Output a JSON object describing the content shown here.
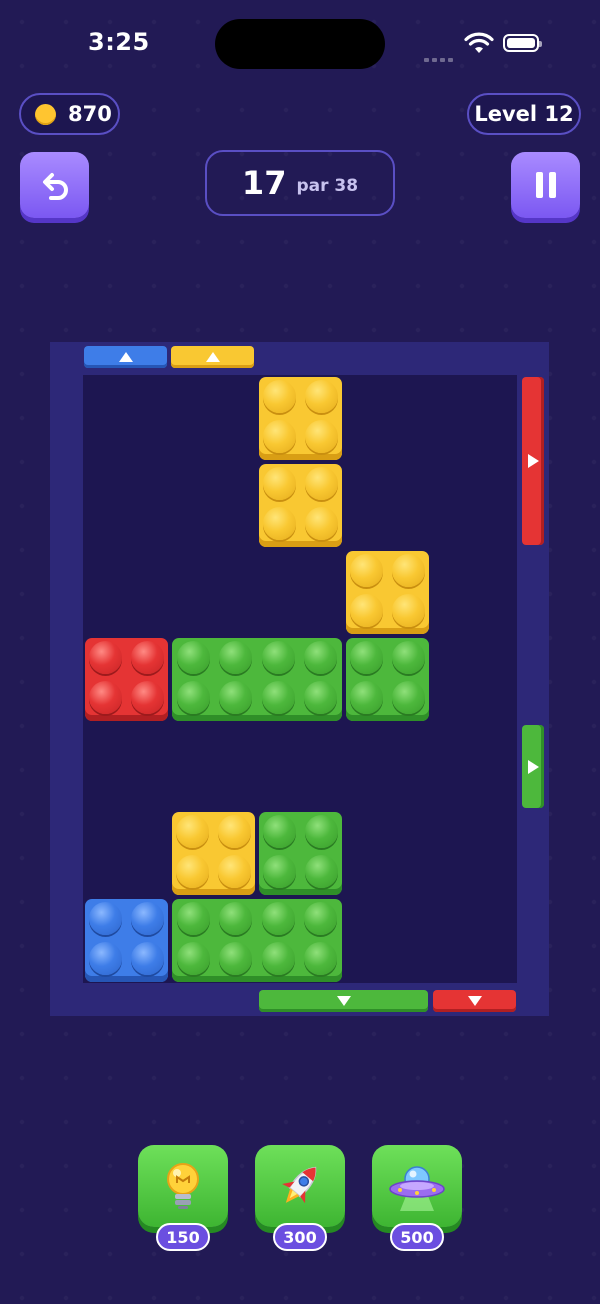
{
  "status_bar": {
    "time": "3:25"
  },
  "header": {
    "coins": "870",
    "level_label": "Level 12",
    "moves": "17",
    "par_label": "par 38"
  },
  "colors": {
    "background": "#221a55",
    "yellow": "#f9c832",
    "green": "#4db83c",
    "red": "#e53434",
    "blue": "#3e7de8",
    "button_purple": "#7b58f2",
    "button_green": "#3eb532"
  },
  "icons": [
    "undo-icon",
    "pause-icon",
    "coin-icon",
    "lightbulb-icon",
    "rocket-icon",
    "ufo-icon"
  ],
  "powerups": [
    {
      "name": "hint",
      "icon": "lightbulb-icon",
      "cost": "150"
    },
    {
      "name": "rocket",
      "icon": "rocket-icon",
      "cost": "300"
    },
    {
      "name": "ufo",
      "icon": "ufo-icon",
      "cost": "500"
    }
  ],
  "board": {
    "grid_cols": 5,
    "grid_rows": 7,
    "blocks": [
      {
        "color": "yellow",
        "col": 2,
        "row": 0,
        "w": 1,
        "h": 1
      },
      {
        "color": "yellow",
        "col": 2,
        "row": 1,
        "w": 1,
        "h": 1
      },
      {
        "color": "yellow",
        "col": 3,
        "row": 2,
        "w": 1,
        "h": 1
      },
      {
        "color": "red",
        "col": 0,
        "row": 3,
        "w": 1,
        "h": 1
      },
      {
        "color": "green",
        "col": 1,
        "row": 3,
        "w": 2,
        "h": 1
      },
      {
        "color": "green",
        "col": 3,
        "row": 3,
        "w": 1,
        "h": 1
      },
      {
        "color": "yellow",
        "col": 1,
        "row": 5,
        "w": 1,
        "h": 1
      },
      {
        "color": "green",
        "col": 2,
        "row": 5,
        "w": 1,
        "h": 1
      },
      {
        "color": "blue",
        "col": 0,
        "row": 6,
        "w": 1,
        "h": 1
      },
      {
        "color": "green",
        "col": 1,
        "row": 6,
        "w": 2,
        "h": 1
      }
    ],
    "exits": [
      {
        "color": "blue",
        "side": "top",
        "direction": "up"
      },
      {
        "color": "yellow",
        "side": "top",
        "direction": "up"
      },
      {
        "color": "red",
        "side": "right",
        "direction": "right"
      },
      {
        "color": "green",
        "side": "right",
        "direction": "right"
      },
      {
        "color": "green",
        "side": "bottom",
        "direction": "down"
      },
      {
        "color": "red",
        "side": "bottom",
        "direction": "down"
      }
    ]
  }
}
